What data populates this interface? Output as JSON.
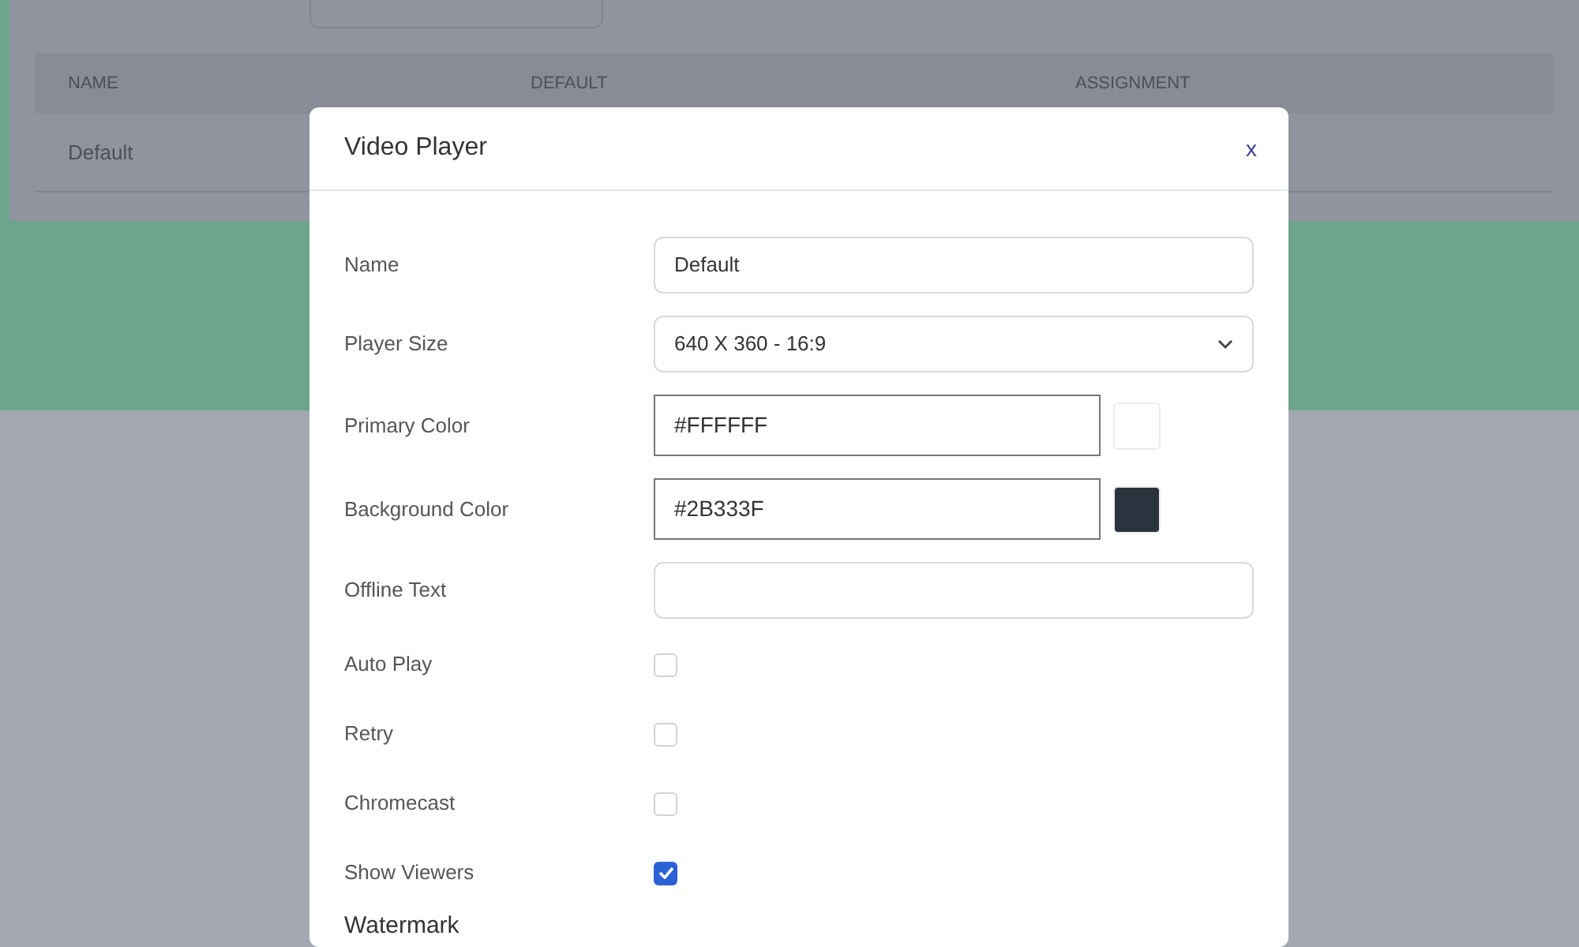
{
  "page": {
    "table": {
      "columns": [
        "NAME",
        "DEFAULT",
        "ASSIGNMENT"
      ],
      "rows": [
        [
          "Default"
        ]
      ]
    }
  },
  "modal": {
    "title": "Video Player",
    "close": "x",
    "fields": [
      {
        "kind": "text",
        "label": "Name",
        "value": "Default"
      },
      {
        "kind": "select",
        "label": "Player Size",
        "value": "640 X 360 - 16:9"
      },
      {
        "kind": "color",
        "label": "Primary Color",
        "value": "#FFFFFF"
      },
      {
        "kind": "color",
        "label": "Background Color",
        "value": "#2B333F"
      },
      {
        "kind": "text",
        "label": "Offline Text"
      },
      {
        "kind": "check",
        "label": "Auto Play",
        "checked": false
      },
      {
        "kind": "check",
        "label": "Retry",
        "checked": false
      },
      {
        "kind": "check",
        "label": "Chromecast",
        "checked": false
      },
      {
        "kind": "check",
        "label": "Show Viewers",
        "checked": true
      }
    ],
    "section": "Watermark"
  }
}
